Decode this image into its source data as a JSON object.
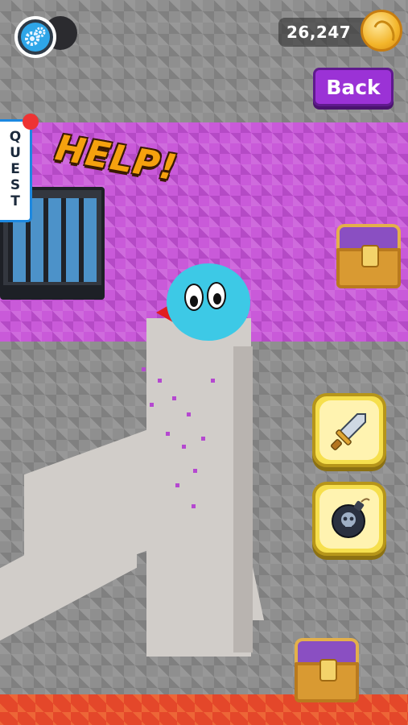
{
  "hud": {
    "coins": "26,247",
    "back_label": "Back",
    "quest_label": "QUEST"
  },
  "scene": {
    "speech_text": "HELP!"
  },
  "actions": {
    "items": [
      "sword",
      "bomb"
    ]
  },
  "colors": {
    "stone": "#8f8f8f",
    "crystal": "#c95ad9",
    "lava": "#e4472a",
    "blob": "#3dc9e6",
    "back_button": "#9b32d6",
    "action_button": "#f6df4d"
  }
}
